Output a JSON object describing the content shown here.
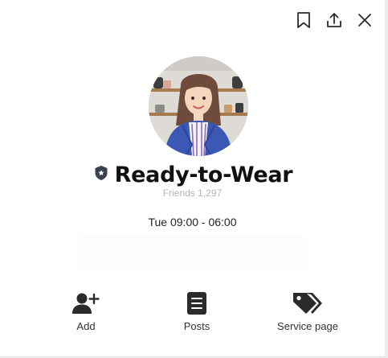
{
  "profile": {
    "name": "Ready-to-Wear",
    "friends": "Friends 1,297",
    "hours": "Tue 09:00 - 06:00"
  },
  "actions": {
    "add": "Add",
    "posts": "Posts",
    "service": "Service page"
  },
  "colors": {
    "icon": "#2b2b2b",
    "badge": "#3a4050",
    "avatar_jacket": "#3a58b4",
    "avatar_hair": "#6e4b3a"
  }
}
